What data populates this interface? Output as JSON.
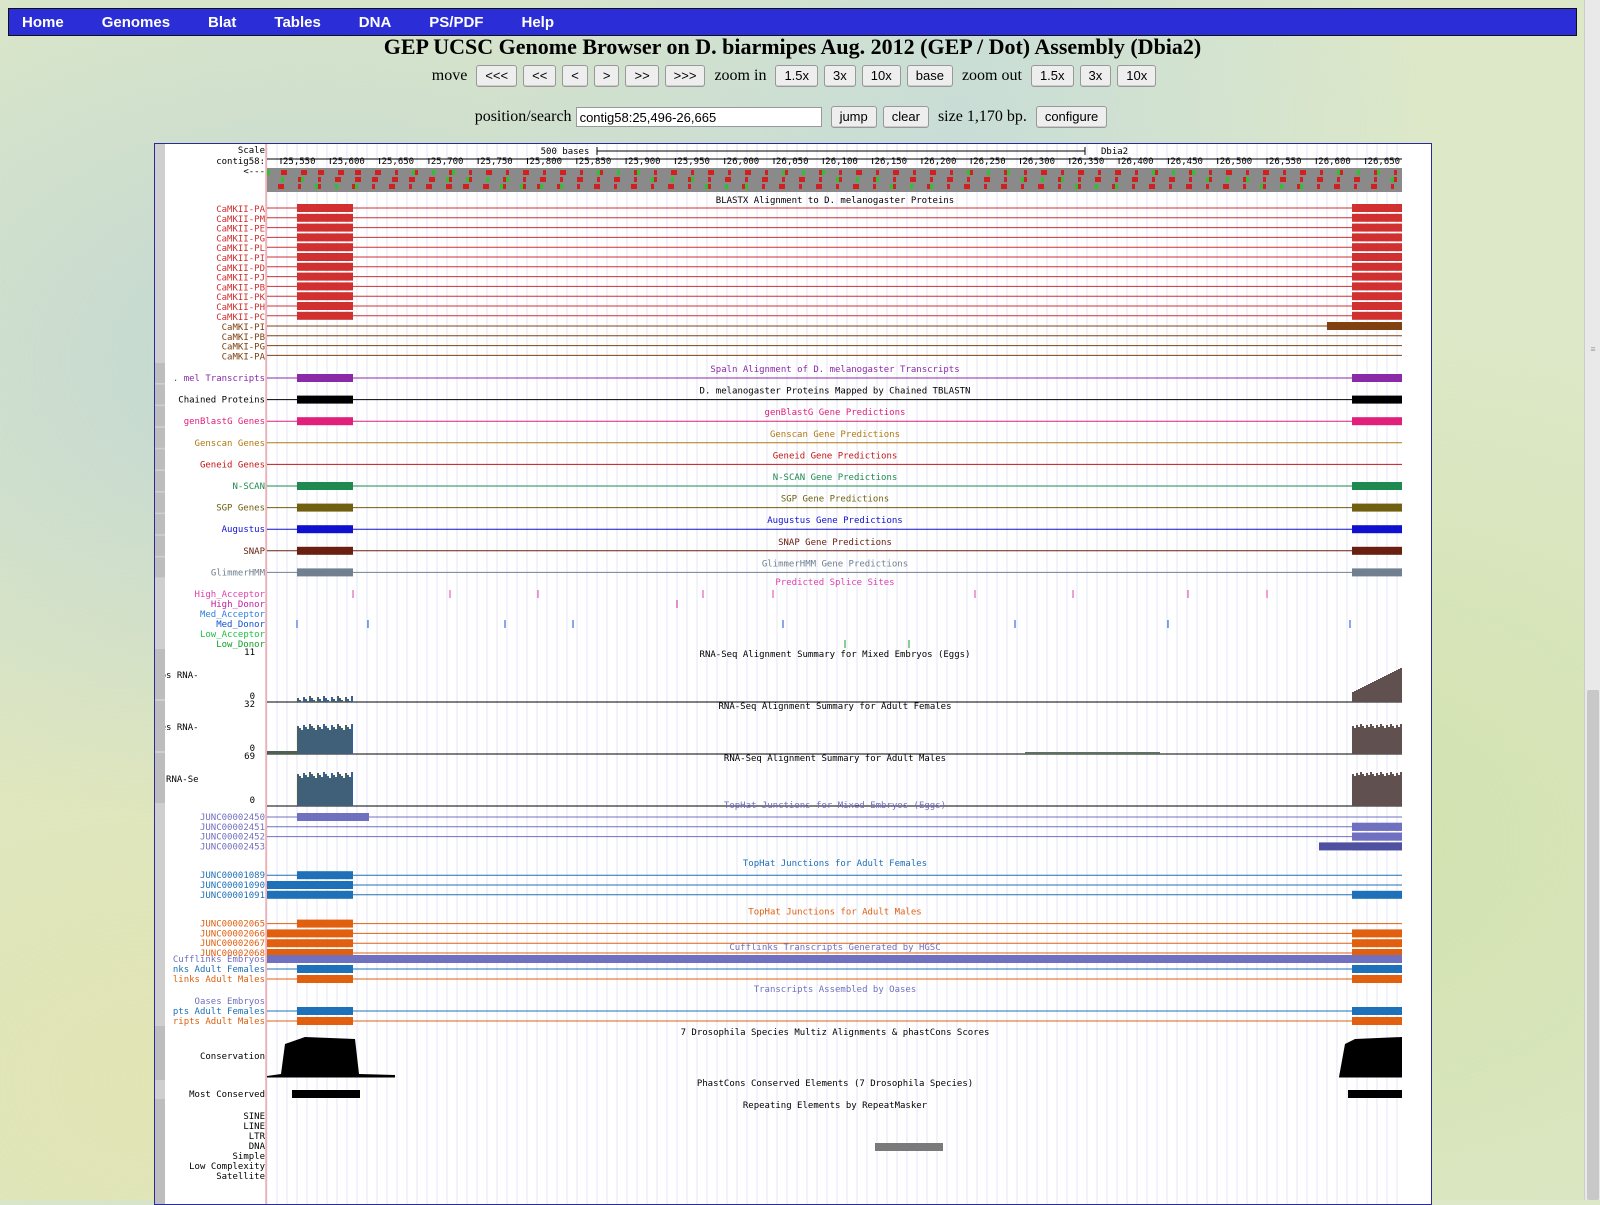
{
  "nav": [
    "Home",
    "Genomes",
    "Blat",
    "Tables",
    "DNA",
    "PS/PDF",
    "Help"
  ],
  "title": "GEP UCSC Genome Browser on D. biarmipes Aug. 2012 (GEP / Dot) Assembly (Dbia2)",
  "move": {
    "label": "move",
    "buttons": [
      "<<<",
      "<<",
      "<",
      ">",
      ">>",
      ">>>"
    ]
  },
  "zoom_in": {
    "label": "zoom in",
    "buttons": [
      "1.5x",
      "3x",
      "10x",
      "base"
    ]
  },
  "zoom_out": {
    "label": "zoom out",
    "buttons": [
      "1.5x",
      "3x",
      "10x"
    ]
  },
  "search": {
    "label": "position/search",
    "value": "contig58:25,496-26,665",
    "jump": "jump",
    "clear": "clear",
    "size_text": "size 1,170 bp.",
    "configure": "configure"
  },
  "scale": {
    "label": "Scale",
    "contig_label": "contig58:",
    "strand": "<---",
    "bar_text": "500 bases",
    "assembly": "Dbia2",
    "ticks": [
      "25,550",
      "25,600",
      "25,650",
      "25,700",
      "25,750",
      "25,800",
      "25,850",
      "25,900",
      "25,950",
      "26,000",
      "26,050",
      "26,100",
      "26,150",
      "26,200",
      "26,250",
      "26,300",
      "26,350",
      "26,400",
      "26,450",
      "26,500",
      "26,550",
      "26,600",
      "26,650"
    ]
  },
  "blastx": {
    "title": "BLASTX Alignment to D. melanogaster Proteins",
    "red_items": [
      "CaMKII-PA",
      "CaMKII-PM",
      "CaMKII-PE",
      "CaMKII-PG",
      "CaMKII-PL",
      "CaMKII-PI",
      "CaMKII-PD",
      "CaMKII-PJ",
      "CaMKII-PB",
      "CaMKII-PK",
      "CaMKII-PH",
      "CaMKII-PC"
    ],
    "brown_items": [
      "CaMKI-PI",
      "CaMKI-PB",
      "CaMKI-PG",
      "CaMKI-PA"
    ]
  },
  "tracks": [
    {
      "label": ". mel Transcripts",
      "title": "Spaln Alignment of D. melanogaster Transcripts",
      "color": "#8a2aa8",
      "blocks": true
    },
    {
      "label": "Chained Proteins",
      "title": "D. melanogaster Proteins Mapped by Chained TBLASTN",
      "color": "#000000",
      "blocks": true
    },
    {
      "label": "genBlastG Genes",
      "title": "genBlastG Gene Predictions",
      "color": "#e0207a",
      "blocks": true
    },
    {
      "label": "Genscan Genes",
      "title": "Genscan Gene Predictions",
      "color": "#b07a10",
      "blocks": false
    },
    {
      "label": "Geneid Genes",
      "title": "Geneid Gene Predictions",
      "color": "#c41515",
      "blocks": false
    },
    {
      "label": "N-SCAN",
      "title": "N-SCAN Gene Predictions",
      "color": "#1e8a50",
      "blocks": true
    },
    {
      "label": "SGP Genes",
      "title": "SGP Gene Predictions",
      "color": "#706010",
      "blocks": true
    },
    {
      "label": "Augustus",
      "title": "Augustus Gene Predictions",
      "color": "#1010d0",
      "blocks": true
    },
    {
      "label": "SNAP",
      "title": "SNAP Gene Predictions",
      "color": "#6a2010",
      "blocks": true
    },
    {
      "label": "GlimmerHMM",
      "title": "GlimmerHMM Gene Predictions",
      "color": "#708090",
      "blocks": true
    }
  ],
  "splice": {
    "title": "Predicted Splice Sites",
    "labels": [
      {
        "text": "High_Acceptor",
        "color": "#e040b0"
      },
      {
        "text": "High_Donor",
        "color": "#c020a0"
      },
      {
        "text": "Med_Acceptor",
        "color": "#3080e0"
      },
      {
        "text": "Med_Donor",
        "color": "#1050d0"
      },
      {
        "text": "Low_Acceptor",
        "color": "#20c040"
      },
      {
        "text": "Low_Donor",
        "color": "#10a020"
      }
    ]
  },
  "rnaseq": [
    {
      "label": "Mixed Embryos RNA-",
      "title": "RNA-Seq Alignment Summary for Mixed Embryos (Eggs)",
      "max": "11",
      "min": "0"
    },
    {
      "label": "Adult Females RNA-",
      "title": "RNA-Seq Alignment Summary for Adult Females",
      "max": "32",
      "min": "0"
    },
    {
      "label": "Adult Males RNA-Se",
      "title": "RNA-Seq Alignment Summary for Adult Males",
      "max": "69",
      "min": "0"
    }
  ],
  "tophat": [
    {
      "title": "TopHat Junctions for Mixed Embryos (Eggs)",
      "color": "#7070c0",
      "items": [
        "JUNC00002450",
        "JUNC00002451",
        "JUNC00002452",
        "JUNC00002453"
      ]
    },
    {
      "title": "TopHat Junctions for Adult Females",
      "color": "#1e70b8",
      "items": [
        "JUNC00001089",
        "JUNC00001090",
        "JUNC00001091"
      ]
    },
    {
      "title": "TopHat Junctions for Adult Males",
      "color": "#e06010",
      "items": [
        "JUNC00002065",
        "JUNC00002066",
        "JUNC00002067",
        "JUNC00002068"
      ]
    }
  ],
  "cufflinks": {
    "title": "Cufflinks Transcripts Generated by HGSC",
    "items": [
      {
        "text": "Cufflinks Embryos",
        "color": "#7070c0"
      },
      {
        "text": "nks Adult Females",
        "color": "#1e70b8"
      },
      {
        "text": "links Adult Males",
        "color": "#e06010"
      }
    ]
  },
  "oases": {
    "title": "Transcripts Assembled by Oases",
    "items": [
      {
        "text": "Oases Embryos",
        "color": "#7070c0"
      },
      {
        "text": "pts Adult Females",
        "color": "#1e70b8"
      },
      {
        "text": "ripts Adult Males",
        "color": "#e06010"
      }
    ]
  },
  "conservation": {
    "title": "7 Drosophila Species Multiz Alignments & phastCons Scores",
    "label": "Conservation"
  },
  "most_conserved": {
    "title": "PhastCons Conserved Elements (7 Drosophila Species)",
    "label": "Most Conserved"
  },
  "repeatmasker": {
    "title": "Repeating Elements by RepeatMasker",
    "labels": [
      "SINE",
      "LINE",
      "LTR",
      "DNA",
      "Simple",
      "Low Complexity",
      "Satellite"
    ]
  }
}
